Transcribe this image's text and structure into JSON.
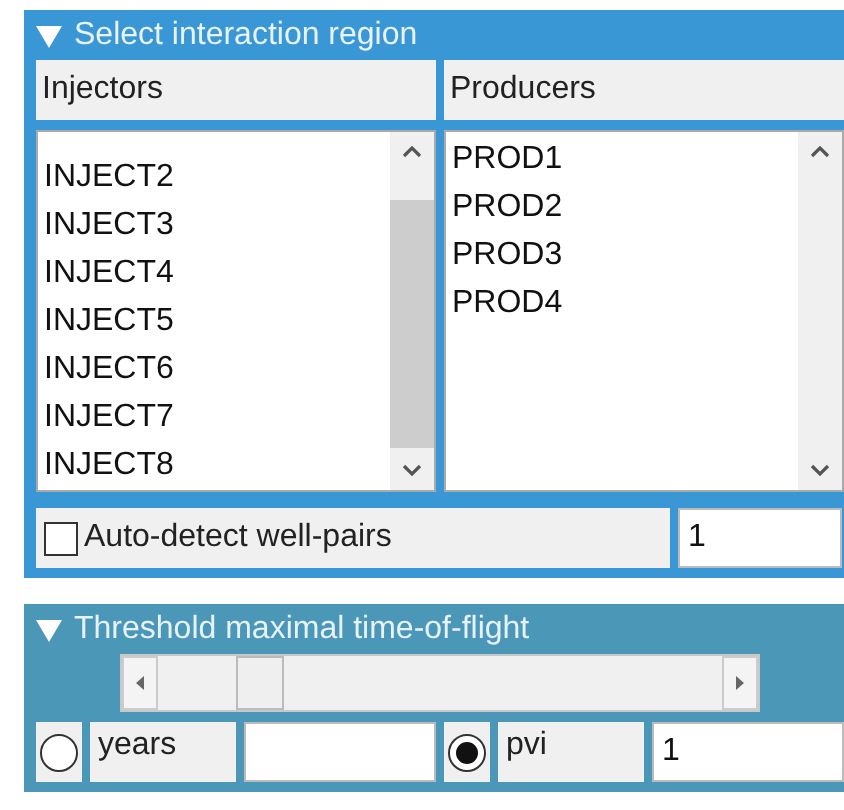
{
  "region_panel": {
    "title": "Select interaction region",
    "expanded": true,
    "injectors": {
      "header": "Injectors",
      "items": [
        "INJECT2",
        "INJECT3",
        "INJECT4",
        "INJECT5",
        "INJECT6",
        "INJECT7",
        "INJECT8"
      ]
    },
    "producers": {
      "header": "Producers",
      "items": [
        "PROD1",
        "PROD2",
        "PROD3",
        "PROD4"
      ]
    },
    "auto_detect": {
      "label": "Auto-detect well-pairs",
      "checked": false,
      "value": "1"
    }
  },
  "tof_panel": {
    "title": "Threshold maximal time-of-flight",
    "expanded": true,
    "slider": {
      "level": 0.15
    },
    "units": [
      {
        "label": "years",
        "selected": false
      },
      {
        "label": "pvi",
        "selected": true,
        "value": "1"
      }
    ]
  }
}
